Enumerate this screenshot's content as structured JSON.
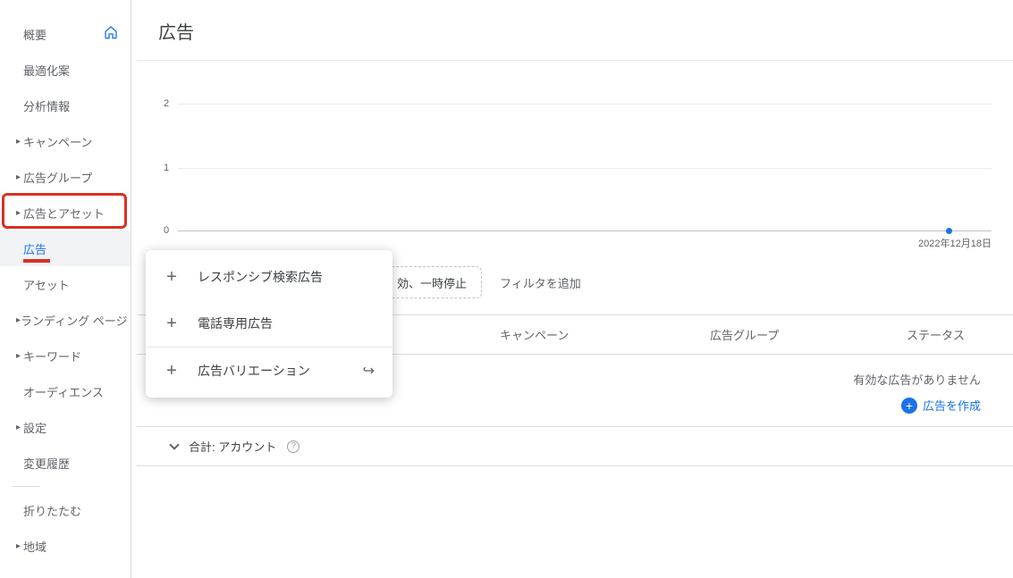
{
  "page": {
    "title": "広告"
  },
  "sidebar": {
    "items": [
      {
        "label": "概要",
        "hasCaret": false,
        "hasHome": true
      },
      {
        "label": "最適化案",
        "hasCaret": false
      },
      {
        "label": "分析情報",
        "hasCaret": false
      },
      {
        "label": "キャンペーン",
        "hasCaret": true
      },
      {
        "label": "広告グループ",
        "hasCaret": true
      },
      {
        "label": "広告とアセット",
        "hasCaret": true
      },
      {
        "label": "広告",
        "sub": true,
        "active": true
      },
      {
        "label": "アセット",
        "sub": true
      },
      {
        "label": "ランディング ページ",
        "hasCaret": true
      },
      {
        "label": "キーワード",
        "hasCaret": true
      },
      {
        "label": "オーディエンス",
        "hasCaret": false
      },
      {
        "label": "設定",
        "hasCaret": true
      },
      {
        "label": "変更履歴",
        "hasCaret": false
      }
    ],
    "collapse_label": "折りたたむ",
    "locations_label": "地域"
  },
  "chart_data": {
    "type": "line",
    "y_ticks": [
      0,
      1,
      2
    ],
    "x_labels": [
      "2022年12月18日"
    ],
    "series": [
      {
        "name": "",
        "values": [
          0
        ]
      }
    ],
    "ylim": [
      0,
      2
    ]
  },
  "toolbar": {
    "status_chip": "効、一時停止",
    "add_filter": "フィルタを追加"
  },
  "table": {
    "headers": {
      "campaign": "キャンペーン",
      "adgroup": "広告グループ",
      "status": "ステータス"
    },
    "empty_message": "有効な広告がありません",
    "create_link": "広告を作成",
    "total_label": "合計: アカウント"
  },
  "popup": {
    "items": [
      {
        "label": "レスポンシブ検索広告"
      },
      {
        "label": "電話専用広告"
      },
      {
        "label": "広告バリエーション",
        "external": true
      }
    ]
  }
}
